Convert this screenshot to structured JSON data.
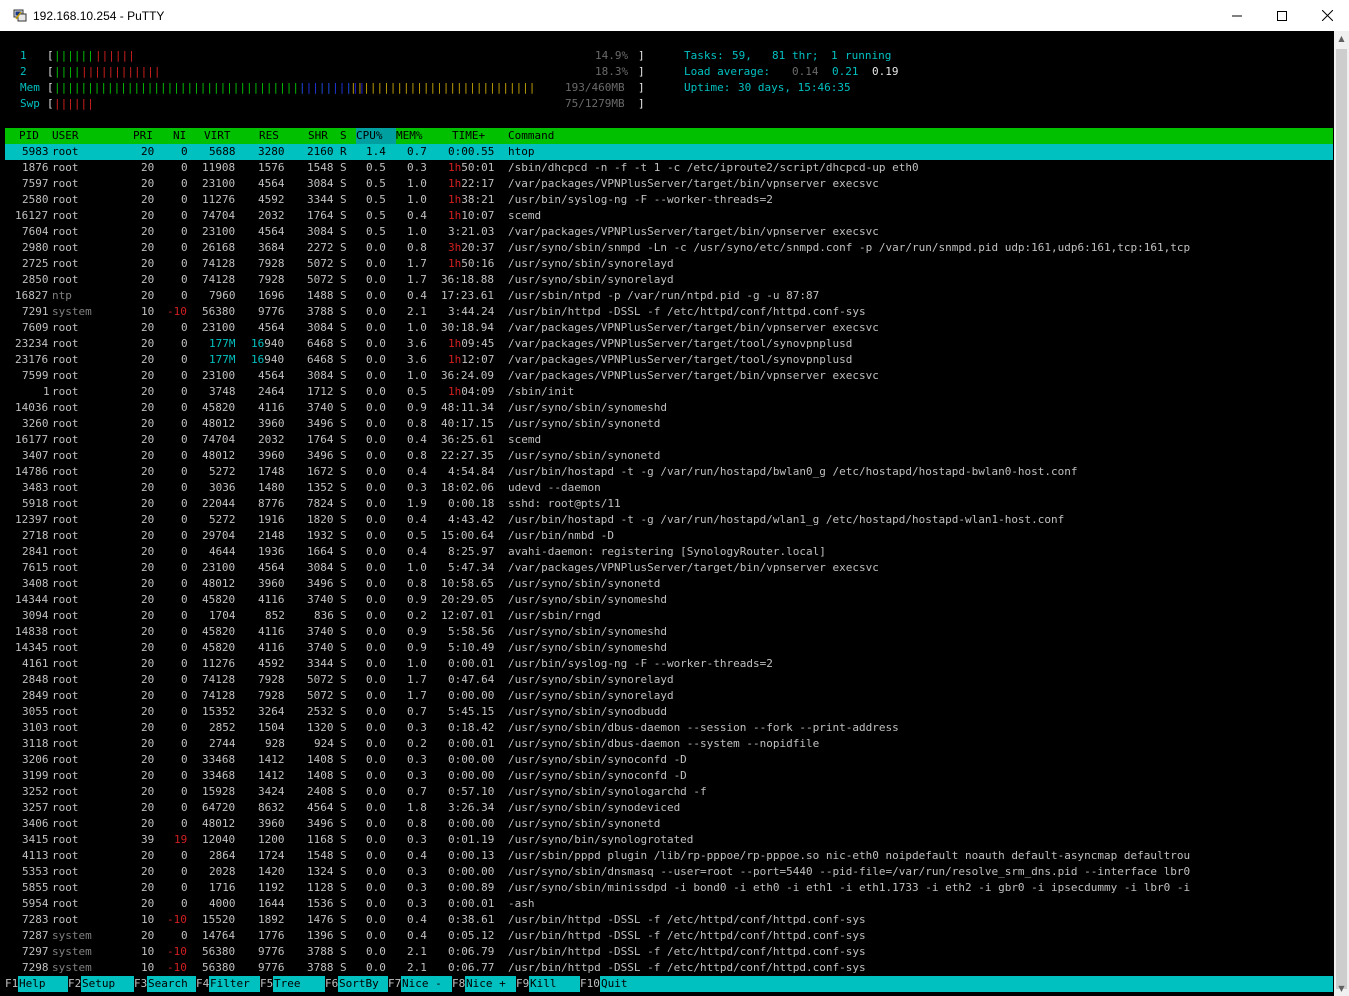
{
  "window": {
    "title": "192.168.10.254 - PuTTY",
    "minimize": "─",
    "maximize": "☐",
    "close": "✕"
  },
  "meters": {
    "cpu1": {
      "label": "1",
      "bars_green": "||||||",
      "bars_red": "||||||",
      "value": "14.9%"
    },
    "cpu2": {
      "label": "2",
      "bars_green": "||||",
      "bars_red": "||||||||||||",
      "value": "18.3%"
    },
    "mem": {
      "label": "Mem",
      "bars_green": "|||||||||||||||||||||||||||||||||||||||||||||",
      "bars_blue": "||||||||||",
      "bars_yellow": "||||||||||||||||||||||||||||",
      "value": "193/460MB"
    },
    "swp": {
      "label": "Swp",
      "bars_red": "||||||",
      "value": "75/1279MB"
    }
  },
  "stats": {
    "tasks_label": "Tasks:",
    "tasks_value": "59,",
    "thr_value": "81",
    "thr_label": "thr;",
    "running_value": "1",
    "running_label": "running",
    "load_label": "Load average:",
    "load1": "0.14",
    "load5": "0.21",
    "load15": "0.19",
    "uptime_label": "Uptime:",
    "uptime_value": "30 days, 15:46:35"
  },
  "columns": [
    "PID",
    "USER",
    "PRI",
    "NI",
    "VIRT",
    "RES",
    "SHR",
    "S",
    "CPU%",
    "MEM%",
    "TIME+",
    "Command"
  ],
  "processes": [
    {
      "pid": "5983",
      "user": "root",
      "pri": "20",
      "ni": "0",
      "virt": "5688",
      "res": "3280",
      "shr": "2160",
      "s": "R",
      "cpu": "1.4",
      "mem": "0.7",
      "time": "0:00.55",
      "cmd": "htop"
    },
    {
      "pid": "1876",
      "user": "root",
      "pri": "20",
      "ni": "0",
      "virt": "11908",
      "res": "1576",
      "shr": "1548",
      "s": "S",
      "cpu": "0.5",
      "mem": "0.3",
      "time": "1h50:01",
      "cmd": "/sbin/dhcpcd -n -f -t 1 -c /etc/iproute2/script/dhcpcd-up eth0"
    },
    {
      "pid": "7597",
      "user": "root",
      "pri": "20",
      "ni": "0",
      "virt": "23100",
      "res": "4564",
      "shr": "3084",
      "s": "S",
      "cpu": "0.5",
      "mem": "1.0",
      "time": "1h22:17",
      "cmd": "/var/packages/VPNPlusServer/target/bin/vpnserver execsvc"
    },
    {
      "pid": "2580",
      "user": "root",
      "pri": "20",
      "ni": "0",
      "virt": "11276",
      "res": "4592",
      "shr": "3344",
      "s": "S",
      "cpu": "0.5",
      "mem": "1.0",
      "time": "1h38:21",
      "cmd": "/usr/bin/syslog-ng -F --worker-threads=2"
    },
    {
      "pid": "16127",
      "user": "root",
      "pri": "20",
      "ni": "0",
      "virt": "74704",
      "res": "2032",
      "shr": "1764",
      "s": "S",
      "cpu": "0.5",
      "mem": "0.4",
      "time": "1h10:07",
      "cmd": "scemd"
    },
    {
      "pid": "7604",
      "user": "root",
      "pri": "20",
      "ni": "0",
      "virt": "23100",
      "res": "4564",
      "shr": "3084",
      "s": "S",
      "cpu": "0.5",
      "mem": "1.0",
      "time": "3:21.03",
      "cmd": "/var/packages/VPNPlusServer/target/bin/vpnserver execsvc"
    },
    {
      "pid": "2980",
      "user": "root",
      "pri": "20",
      "ni": "0",
      "virt": "26168",
      "res": "3684",
      "shr": "2272",
      "s": "S",
      "cpu": "0.0",
      "mem": "0.8",
      "time": "3h20:37",
      "cmd": "/usr/syno/sbin/snmpd -Ln -c /usr/syno/etc/snmpd.conf -p /var/run/snmpd.pid udp:161,udp6:161,tcp:161,tcp"
    },
    {
      "pid": "2725",
      "user": "root",
      "pri": "20",
      "ni": "0",
      "virt": "74128",
      "res": "7928",
      "shr": "5072",
      "s": "S",
      "cpu": "0.0",
      "mem": "1.7",
      "time": "1h50:16",
      "cmd": "/usr/syno/sbin/synorelayd"
    },
    {
      "pid": "2850",
      "user": "root",
      "pri": "20",
      "ni": "0",
      "virt": "74128",
      "res": "7928",
      "shr": "5072",
      "s": "S",
      "cpu": "0.0",
      "mem": "1.7",
      "time": "36:18.88",
      "cmd": "/usr/syno/sbin/synorelayd"
    },
    {
      "pid": "16827",
      "user": "ntp",
      "pri": "20",
      "ni": "0",
      "virt": "7960",
      "res": "1696",
      "shr": "1488",
      "s": "S",
      "cpu": "0.0",
      "mem": "0.4",
      "time": "17:23.61",
      "cmd": "/usr/sbin/ntpd -p /var/run/ntpd.pid -g -u 87:87"
    },
    {
      "pid": "7291",
      "user": "system",
      "pri": "10",
      "ni": "-10",
      "virt": "56380",
      "res": "9776",
      "shr": "3788",
      "s": "S",
      "cpu": "0.0",
      "mem": "2.1",
      "time": "3:44.24",
      "cmd": "/usr/bin/httpd -DSSL -f /etc/httpd/conf/httpd.conf-sys"
    },
    {
      "pid": "7609",
      "user": "root",
      "pri": "20",
      "ni": "0",
      "virt": "23100",
      "res": "4564",
      "shr": "3084",
      "s": "S",
      "cpu": "0.0",
      "mem": "1.0",
      "time": "30:18.94",
      "cmd": "/var/packages/VPNPlusServer/target/bin/vpnserver execsvc"
    },
    {
      "pid": "23234",
      "user": "root",
      "pri": "20",
      "ni": "0",
      "virt": "177M",
      "res": "16940",
      "shr": "6468",
      "s": "S",
      "cpu": "0.0",
      "mem": "3.6",
      "time": "1h09:45",
      "cmd": "/var/packages/VPNPlusServer/target/tool/synovpnplusd"
    },
    {
      "pid": "23176",
      "user": "root",
      "pri": "20",
      "ni": "0",
      "virt": "177M",
      "res": "16940",
      "shr": "6468",
      "s": "S",
      "cpu": "0.0",
      "mem": "3.6",
      "time": "1h12:07",
      "cmd": "/var/packages/VPNPlusServer/target/tool/synovpnplusd"
    },
    {
      "pid": "7599",
      "user": "root",
      "pri": "20",
      "ni": "0",
      "virt": "23100",
      "res": "4564",
      "shr": "3084",
      "s": "S",
      "cpu": "0.0",
      "mem": "1.0",
      "time": "36:24.09",
      "cmd": "/var/packages/VPNPlusServer/target/bin/vpnserver execsvc"
    },
    {
      "pid": "1",
      "user": "root",
      "pri": "20",
      "ni": "0",
      "virt": "3748",
      "res": "2464",
      "shr": "1712",
      "s": "S",
      "cpu": "0.0",
      "mem": "0.5",
      "time": "1h04:09",
      "cmd": "/sbin/init"
    },
    {
      "pid": "14036",
      "user": "root",
      "pri": "20",
      "ni": "0",
      "virt": "45820",
      "res": "4116",
      "shr": "3740",
      "s": "S",
      "cpu": "0.0",
      "mem": "0.9",
      "time": "48:11.34",
      "cmd": "/usr/syno/sbin/synomeshd"
    },
    {
      "pid": "3260",
      "user": "root",
      "pri": "20",
      "ni": "0",
      "virt": "48012",
      "res": "3960",
      "shr": "3496",
      "s": "S",
      "cpu": "0.0",
      "mem": "0.8",
      "time": "40:17.15",
      "cmd": "/usr/syno/sbin/synonetd"
    },
    {
      "pid": "16177",
      "user": "root",
      "pri": "20",
      "ni": "0",
      "virt": "74704",
      "res": "2032",
      "shr": "1764",
      "s": "S",
      "cpu": "0.0",
      "mem": "0.4",
      "time": "36:25.61",
      "cmd": "scemd"
    },
    {
      "pid": "3407",
      "user": "root",
      "pri": "20",
      "ni": "0",
      "virt": "48012",
      "res": "3960",
      "shr": "3496",
      "s": "S",
      "cpu": "0.0",
      "mem": "0.8",
      "time": "22:27.35",
      "cmd": "/usr/syno/sbin/synonetd"
    },
    {
      "pid": "14786",
      "user": "root",
      "pri": "20",
      "ni": "0",
      "virt": "5272",
      "res": "1748",
      "shr": "1672",
      "s": "S",
      "cpu": "0.0",
      "mem": "0.4",
      "time": "4:54.84",
      "cmd": "/usr/bin/hostapd -t -g /var/run/hostapd/bwlan0_g /etc/hostapd/hostapd-bwlan0-host.conf"
    },
    {
      "pid": "3483",
      "user": "root",
      "pri": "20",
      "ni": "0",
      "virt": "3036",
      "res": "1480",
      "shr": "1352",
      "s": "S",
      "cpu": "0.0",
      "mem": "0.3",
      "time": "18:02.06",
      "cmd": "udevd --daemon"
    },
    {
      "pid": "5918",
      "user": "root",
      "pri": "20",
      "ni": "0",
      "virt": "22044",
      "res": "8776",
      "shr": "7824",
      "s": "S",
      "cpu": "0.0",
      "mem": "1.9",
      "time": "0:00.18",
      "cmd": "sshd: root@pts/11"
    },
    {
      "pid": "12397",
      "user": "root",
      "pri": "20",
      "ni": "0",
      "virt": "5272",
      "res": "1916",
      "shr": "1820",
      "s": "S",
      "cpu": "0.0",
      "mem": "0.4",
      "time": "4:43.42",
      "cmd": "/usr/bin/hostapd -t -g /var/run/hostapd/wlan1_g /etc/hostapd/hostapd-wlan1-host.conf"
    },
    {
      "pid": "2718",
      "user": "root",
      "pri": "20",
      "ni": "0",
      "virt": "29704",
      "res": "2148",
      "shr": "1932",
      "s": "S",
      "cpu": "0.0",
      "mem": "0.5",
      "time": "15:00.64",
      "cmd": "/usr/bin/nmbd -D"
    },
    {
      "pid": "2841",
      "user": "root",
      "pri": "20",
      "ni": "0",
      "virt": "4644",
      "res": "1936",
      "shr": "1664",
      "s": "S",
      "cpu": "0.0",
      "mem": "0.4",
      "time": "8:25.97",
      "cmd": "avahi-daemon: registering [SynologyRouter.local]"
    },
    {
      "pid": "7615",
      "user": "root",
      "pri": "20",
      "ni": "0",
      "virt": "23100",
      "res": "4564",
      "shr": "3084",
      "s": "S",
      "cpu": "0.0",
      "mem": "1.0",
      "time": "5:47.34",
      "cmd": "/var/packages/VPNPlusServer/target/bin/vpnserver execsvc"
    },
    {
      "pid": "3408",
      "user": "root",
      "pri": "20",
      "ni": "0",
      "virt": "48012",
      "res": "3960",
      "shr": "3496",
      "s": "S",
      "cpu": "0.0",
      "mem": "0.8",
      "time": "10:58.65",
      "cmd": "/usr/syno/sbin/synonetd"
    },
    {
      "pid": "14344",
      "user": "root",
      "pri": "20",
      "ni": "0",
      "virt": "45820",
      "res": "4116",
      "shr": "3740",
      "s": "S",
      "cpu": "0.0",
      "mem": "0.9",
      "time": "20:29.05",
      "cmd": "/usr/syno/sbin/synomeshd"
    },
    {
      "pid": "3094",
      "user": "root",
      "pri": "20",
      "ni": "0",
      "virt": "1704",
      "res": "852",
      "shr": "836",
      "s": "S",
      "cpu": "0.0",
      "mem": "0.2",
      "time": "12:07.01",
      "cmd": "/usr/sbin/rngd"
    },
    {
      "pid": "14838",
      "user": "root",
      "pri": "20",
      "ni": "0",
      "virt": "45820",
      "res": "4116",
      "shr": "3740",
      "s": "S",
      "cpu": "0.0",
      "mem": "0.9",
      "time": "5:58.56",
      "cmd": "/usr/syno/sbin/synomeshd"
    },
    {
      "pid": "14345",
      "user": "root",
      "pri": "20",
      "ni": "0",
      "virt": "45820",
      "res": "4116",
      "shr": "3740",
      "s": "S",
      "cpu": "0.0",
      "mem": "0.9",
      "time": "5:10.49",
      "cmd": "/usr/syno/sbin/synomeshd"
    },
    {
      "pid": "4161",
      "user": "root",
      "pri": "20",
      "ni": "0",
      "virt": "11276",
      "res": "4592",
      "shr": "3344",
      "s": "S",
      "cpu": "0.0",
      "mem": "1.0",
      "time": "0:00.01",
      "cmd": "/usr/bin/syslog-ng -F --worker-threads=2"
    },
    {
      "pid": "2848",
      "user": "root",
      "pri": "20",
      "ni": "0",
      "virt": "74128",
      "res": "7928",
      "shr": "5072",
      "s": "S",
      "cpu": "0.0",
      "mem": "1.7",
      "time": "0:47.64",
      "cmd": "/usr/syno/sbin/synorelayd"
    },
    {
      "pid": "2849",
      "user": "root",
      "pri": "20",
      "ni": "0",
      "virt": "74128",
      "res": "7928",
      "shr": "5072",
      "s": "S",
      "cpu": "0.0",
      "mem": "1.7",
      "time": "0:00.00",
      "cmd": "/usr/syno/sbin/synorelayd"
    },
    {
      "pid": "3055",
      "user": "root",
      "pri": "20",
      "ni": "0",
      "virt": "15352",
      "res": "3264",
      "shr": "2532",
      "s": "S",
      "cpu": "0.0",
      "mem": "0.7",
      "time": "5:45.15",
      "cmd": "/usr/syno/sbin/synodbudd"
    },
    {
      "pid": "3103",
      "user": "root",
      "pri": "20",
      "ni": "0",
      "virt": "2852",
      "res": "1504",
      "shr": "1320",
      "s": "S",
      "cpu": "0.0",
      "mem": "0.3",
      "time": "0:18.42",
      "cmd": "/usr/syno/sbin/dbus-daemon --session --fork --print-address"
    },
    {
      "pid": "3118",
      "user": "root",
      "pri": "20",
      "ni": "0",
      "virt": "2744",
      "res": "928",
      "shr": "924",
      "s": "S",
      "cpu": "0.0",
      "mem": "0.2",
      "time": "0:00.01",
      "cmd": "/usr/syno/sbin/dbus-daemon --system --nopidfile"
    },
    {
      "pid": "3206",
      "user": "root",
      "pri": "20",
      "ni": "0",
      "virt": "33468",
      "res": "1412",
      "shr": "1408",
      "s": "S",
      "cpu": "0.0",
      "mem": "0.3",
      "time": "0:00.00",
      "cmd": "/usr/syno/sbin/synoconfd -D"
    },
    {
      "pid": "3199",
      "user": "root",
      "pri": "20",
      "ni": "0",
      "virt": "33468",
      "res": "1412",
      "shr": "1408",
      "s": "S",
      "cpu": "0.0",
      "mem": "0.3",
      "time": "0:00.00",
      "cmd": "/usr/syno/sbin/synoconfd -D"
    },
    {
      "pid": "3252",
      "user": "root",
      "pri": "20",
      "ni": "0",
      "virt": "15928",
      "res": "3424",
      "shr": "2408",
      "s": "S",
      "cpu": "0.0",
      "mem": "0.7",
      "time": "0:57.10",
      "cmd": "/usr/syno/sbin/synologarchd -f"
    },
    {
      "pid": "3257",
      "user": "root",
      "pri": "20",
      "ni": "0",
      "virt": "64720",
      "res": "8632",
      "shr": "4564",
      "s": "S",
      "cpu": "0.0",
      "mem": "1.8",
      "time": "3:26.34",
      "cmd": "/usr/syno/sbin/synodeviced"
    },
    {
      "pid": "3406",
      "user": "root",
      "pri": "20",
      "ni": "0",
      "virt": "48012",
      "res": "3960",
      "shr": "3496",
      "s": "S",
      "cpu": "0.0",
      "mem": "0.8",
      "time": "0:00.00",
      "cmd": "/usr/syno/sbin/synonetd"
    },
    {
      "pid": "3415",
      "user": "root",
      "pri": "39",
      "ni": "19",
      "virt": "12040",
      "res": "1200",
      "shr": "1168",
      "s": "S",
      "cpu": "0.0",
      "mem": "0.3",
      "time": "0:01.19",
      "cmd": "/usr/syno/bin/synologrotated"
    },
    {
      "pid": "4113",
      "user": "root",
      "pri": "20",
      "ni": "0",
      "virt": "2864",
      "res": "1724",
      "shr": "1548",
      "s": "S",
      "cpu": "0.0",
      "mem": "0.4",
      "time": "0:00.13",
      "cmd": "/usr/sbin/pppd plugin /lib/rp-pppoe/rp-pppoe.so nic-eth0 noipdefault noauth default-asyncmap defaultrou"
    },
    {
      "pid": "5353",
      "user": "root",
      "pri": "20",
      "ni": "0",
      "virt": "2028",
      "res": "1420",
      "shr": "1324",
      "s": "S",
      "cpu": "0.0",
      "mem": "0.3",
      "time": "0:00.00",
      "cmd": "/usr/syno/sbin/dnsmasq --user=root --port=5440 --pid-file=/var/run/resolve_srm_dns.pid --interface lbr0"
    },
    {
      "pid": "5855",
      "user": "root",
      "pri": "20",
      "ni": "0",
      "virt": "1716",
      "res": "1192",
      "shr": "1128",
      "s": "S",
      "cpu": "0.0",
      "mem": "0.3",
      "time": "0:00.89",
      "cmd": "/usr/syno/sbin/minissdpd -i bond0 -i eth0 -i eth1 -i eth1.1733 -i eth2 -i gbr0 -i ipsecdummy -i lbr0 -i"
    },
    {
      "pid": "5954",
      "user": "root",
      "pri": "20",
      "ni": "0",
      "virt": "4000",
      "res": "1644",
      "shr": "1536",
      "s": "S",
      "cpu": "0.0",
      "mem": "0.3",
      "time": "0:00.01",
      "cmd": "-ash"
    },
    {
      "pid": "7283",
      "user": "root",
      "pri": "10",
      "ni": "-10",
      "virt": "15520",
      "res": "1892",
      "shr": "1476",
      "s": "S",
      "cpu": "0.0",
      "mem": "0.4",
      "time": "0:38.61",
      "cmd": "/usr/bin/httpd -DSSL -f /etc/httpd/conf/httpd.conf-sys"
    },
    {
      "pid": "7287",
      "user": "system",
      "pri": "20",
      "ni": "0",
      "virt": "14764",
      "res": "1776",
      "shr": "1396",
      "s": "S",
      "cpu": "0.0",
      "mem": "0.4",
      "time": "0:05.12",
      "cmd": "/usr/bin/httpd -DSSL -f /etc/httpd/conf/httpd.conf-sys"
    },
    {
      "pid": "7297",
      "user": "system",
      "pri": "10",
      "ni": "-10",
      "virt": "56380",
      "res": "9776",
      "shr": "3788",
      "s": "S",
      "cpu": "0.0",
      "mem": "2.1",
      "time": "0:06.79",
      "cmd": "/usr/bin/httpd -DSSL -f /etc/httpd/conf/httpd.conf-sys"
    },
    {
      "pid": "7298",
      "user": "system",
      "pri": "10",
      "ni": "-10",
      "virt": "56380",
      "res": "9776",
      "shr": "3788",
      "s": "S",
      "cpu": "0.0",
      "mem": "2.1",
      "time": "0:06.77",
      "cmd": "/usr/bin/httpd -DSSL -f /etc/httpd/conf/httpd.conf-sys"
    }
  ],
  "fkeys": [
    {
      "key": "F1",
      "label": "Help"
    },
    {
      "key": "F2",
      "label": "Setup"
    },
    {
      "key": "F3",
      "label": "Search"
    },
    {
      "key": "F4",
      "label": "Filter"
    },
    {
      "key": "F5",
      "label": "Tree"
    },
    {
      "key": "F6",
      "label": "SortBy"
    },
    {
      "key": "F7",
      "label": "Nice -"
    },
    {
      "key": "F8",
      "label": "Nice +"
    },
    {
      "key": "F9",
      "label": "Kill"
    },
    {
      "key": "F10",
      "label": "Quit"
    }
  ],
  "colors": {
    "terminal_bg": "#000000",
    "header_green": "#00c000",
    "selection_cyan": "#00c0c0",
    "text_gray": "#c0c0c0"
  }
}
